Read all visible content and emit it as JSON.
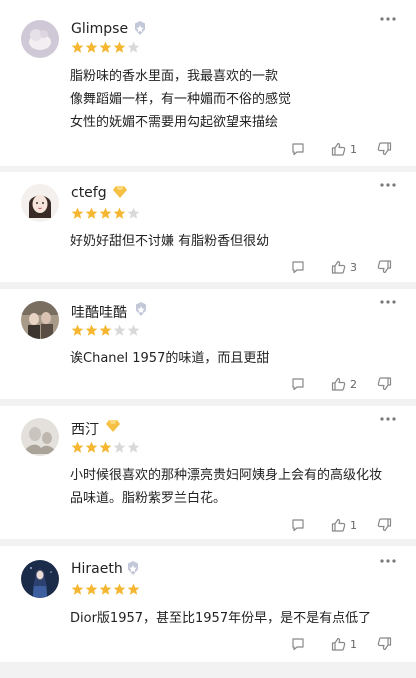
{
  "reviews": [
    {
      "username": "Glimpse",
      "rating": 4,
      "badge": "silver-badge-icon",
      "content": "脂粉味的香水里面，我最喜欢的一款\n像舞蹈媚一样，有一种媚而不俗的感觉\n女性的妩媚不需要用勾起欲望来描绘",
      "likes": "1"
    },
    {
      "username": "ctefg",
      "rating": 4,
      "badge": "gold-badge-icon",
      "content": "好奶好甜但不讨嫌 有脂粉香但很幼",
      "likes": "3"
    },
    {
      "username": "哇酷哇酷",
      "rating": 3,
      "badge": "silver-badge-icon",
      "content": "诶Chanel 1957的味道，而且更甜",
      "likes": "2"
    },
    {
      "username": "西汀",
      "rating": 3,
      "badge": "gold-badge-icon",
      "content": "小时候很喜欢的那种漂亮贵妇阿姨身上会有的高级化妆品味道。脂粉紫罗兰白花。",
      "likes": "1"
    },
    {
      "username": "Hiraeth",
      "rating": 5,
      "badge": "silver-badge-icon",
      "content": "Dior版1957，甚至比1957年份早，是不是有点低了",
      "likes": "1"
    }
  ],
  "colors": {
    "star_filled": "#f5b731",
    "star_empty": "#d9d9d9",
    "badge_gold": "#f5c044",
    "badge_silver": "#c3c8d8",
    "icon_gray": "#888888"
  }
}
